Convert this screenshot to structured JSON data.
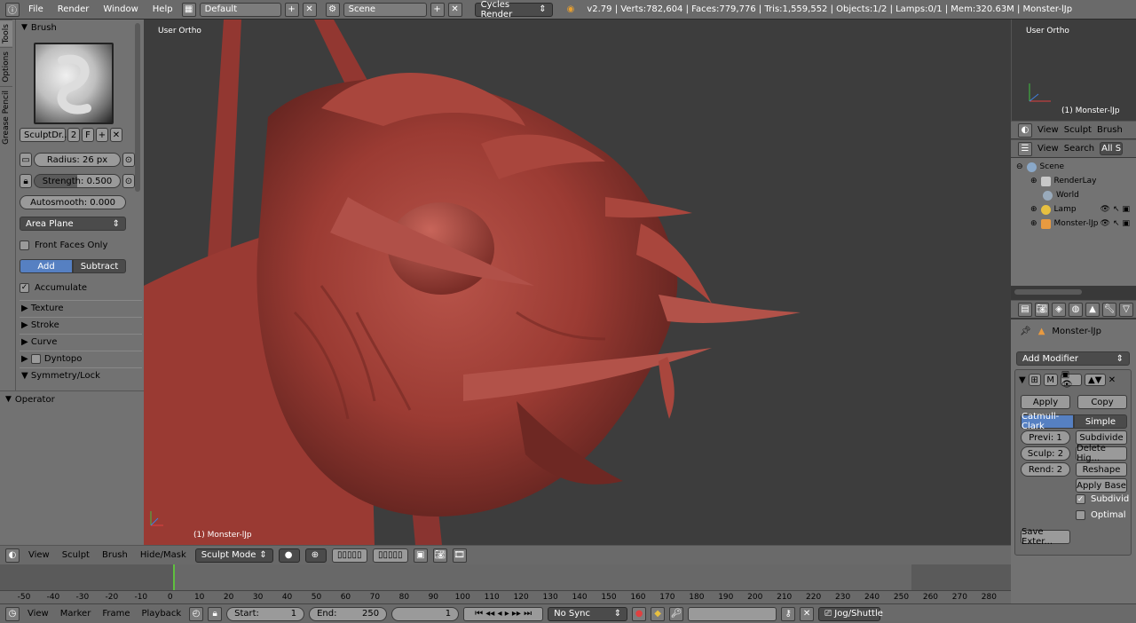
{
  "topbar": {
    "menus": [
      "File",
      "Render",
      "Window",
      "Help"
    ],
    "screen_layout": "Default",
    "scene": "Scene",
    "render_engine": "Cycles Render",
    "stats": "v2.79 | Verts:782,604 | Faces:779,776 | Tris:1,559,552 | Objects:1/2 | Lamps:0/1 | Mem:320.63M | Monster-lJp"
  },
  "toolstrip": {
    "tabs": [
      "Tools",
      "Options",
      "Grease Pencil"
    ]
  },
  "brush_panel": {
    "title": "Brush",
    "brush_name": "SculptDr...",
    "users": "2",
    "fake_user": "F",
    "radius_label": "Radius:",
    "radius_value": "26 px",
    "strength_label": "Strength:",
    "strength_value": "0.500",
    "autosmooth_label": "Autosmooth:",
    "autosmooth_value": "0.000",
    "sculpt_plane": "Area Plane",
    "front_faces_only": "Front Faces Only",
    "add": "Add",
    "subtract": "Subtract",
    "accumulate": "Accumulate",
    "subpanels": [
      "Texture",
      "Stroke",
      "Curve",
      "Dyntopo",
      "Symmetry/Lock"
    ]
  },
  "operator_panel": {
    "title": "Operator"
  },
  "viewport": {
    "view_label": "User Ortho",
    "object_label": "(1) Monster-lJp",
    "colors": {
      "background": "#3d3d3d",
      "mesh": "#9b3b33"
    }
  },
  "miniview": {
    "view_label": "User Ortho",
    "object_label": "(1) Monster-lJp"
  },
  "outliner_header": {
    "menus": [
      "View",
      "Sculpt",
      "Brush"
    ]
  },
  "outliner_search_header": {
    "menus": [
      "View",
      "Search"
    ],
    "filter": "All S"
  },
  "outliner": {
    "rows": [
      {
        "label": "Scene",
        "icon": "scene-icon",
        "color": "#8aa8c8"
      },
      {
        "label": "RenderLay",
        "icon": "render-layers-icon",
        "color": "#c8c8c8"
      },
      {
        "label": "World",
        "icon": "world-icon",
        "color": "#9ab"
      },
      {
        "label": "Lamp",
        "icon": "lamp-icon",
        "color": "#e8c040"
      },
      {
        "label": "Monster-lJp",
        "icon": "mesh-icon",
        "color": "#e89a40"
      }
    ]
  },
  "properties": {
    "object_name": "Monster-lJp",
    "add_modifier": "Add Modifier",
    "modifier_short": "M",
    "apply": "Apply",
    "copy": "Copy",
    "catmull_clark": "Catmull-Clark",
    "simple": "Simple",
    "preview_levels": "Previ: 1",
    "sculpt_levels": "Sculp: 2",
    "render_levels": "Rend: 2",
    "subdivide": "Subdivide",
    "delete_higher": "Delete Hig...",
    "reshape": "Reshape",
    "apply_base": "Apply Base",
    "subdivide_uvs": "Subdivid",
    "optimal_display": "Optimal",
    "save_external": "Save Exter..."
  },
  "view_header": {
    "menus": [
      "View",
      "Sculpt",
      "Brush",
      "Hide/Mask"
    ],
    "mode": "Sculpt Mode"
  },
  "timeline": {
    "ticks": [
      "-50",
      "-40",
      "-30",
      "-20",
      "-10",
      "0",
      "10",
      "20",
      "30",
      "40",
      "50",
      "60",
      "70",
      "80",
      "90",
      "100",
      "110",
      "120",
      "130",
      "140",
      "150",
      "160",
      "170",
      "180",
      "190",
      "200",
      "210",
      "220",
      "230",
      "240",
      "250",
      "260",
      "270",
      "280"
    ],
    "current_frame_color": "#5fbf3f"
  },
  "timeline_header": {
    "menus": [
      "View",
      "Marker",
      "Frame",
      "Playback"
    ],
    "start_label": "Start:",
    "start_value": "1",
    "end_label": "End:",
    "end_value": "250",
    "current_frame": "1",
    "sync": "No Sync",
    "keying_set": "Jog/Shuttle"
  }
}
